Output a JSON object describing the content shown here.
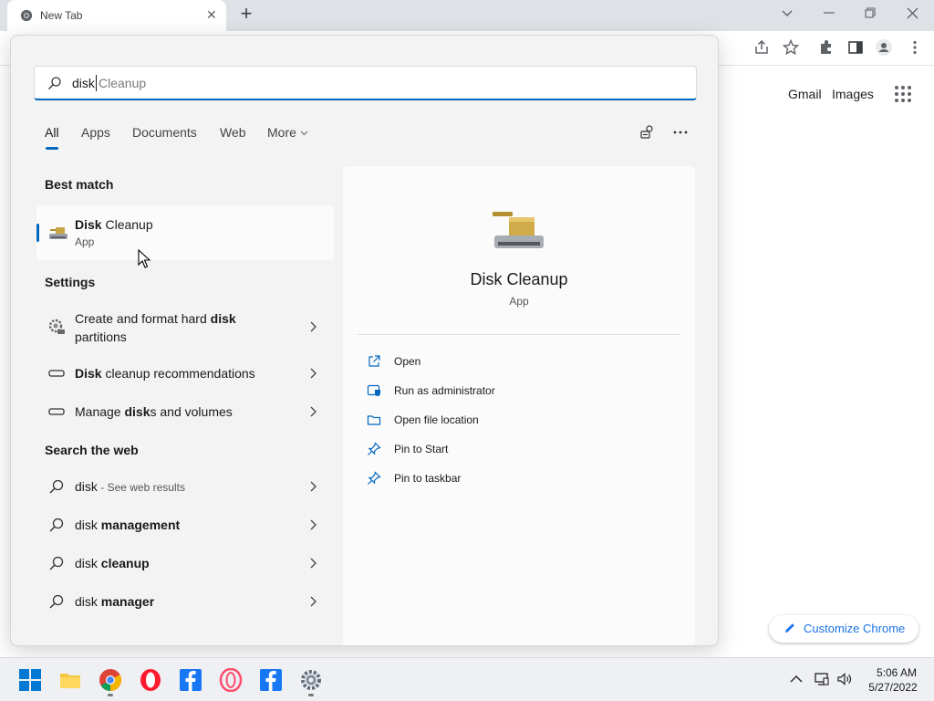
{
  "browser": {
    "tab_title": "New Tab",
    "page_links": {
      "gmail": "Gmail",
      "images": "Images"
    },
    "customize_label": "Customize Chrome"
  },
  "search": {
    "typed_text": "disk",
    "suggestion_text": " Cleanup",
    "filters": [
      "All",
      "Apps",
      "Documents",
      "Web",
      "More"
    ],
    "active_filter": "All"
  },
  "best_match": {
    "section_title": "Best match",
    "title_bold": "Disk",
    "title_rest": " Cleanup",
    "type": "App"
  },
  "settings": {
    "section_title": "Settings",
    "items": [
      {
        "pre": "Create and format hard ",
        "bold": "disk",
        "post": "",
        "line2": "partitions"
      },
      {
        "pre": "",
        "bold": "Disk",
        "post": " cleanup recommendations"
      },
      {
        "pre": "Manage ",
        "bold": "disk",
        "post": "s and volumes"
      }
    ]
  },
  "web": {
    "section_title": "Search the web",
    "first_query": "disk",
    "first_suffix": " - See web results",
    "items": [
      {
        "pre": "disk ",
        "bold": "management"
      },
      {
        "pre": "disk ",
        "bold": "cleanup"
      },
      {
        "pre": "disk ",
        "bold": "manager"
      }
    ]
  },
  "preview": {
    "title": "Disk Cleanup",
    "type": "App",
    "actions": [
      "Open",
      "Run as administrator",
      "Open file location",
      "Pin to Start",
      "Pin to taskbar"
    ]
  },
  "taskbar": {
    "time": "5:06 AM",
    "date": "5/27/2022"
  },
  "colors": {
    "accent": "#0067c0",
    "chrome_link": "#1a73e8"
  }
}
